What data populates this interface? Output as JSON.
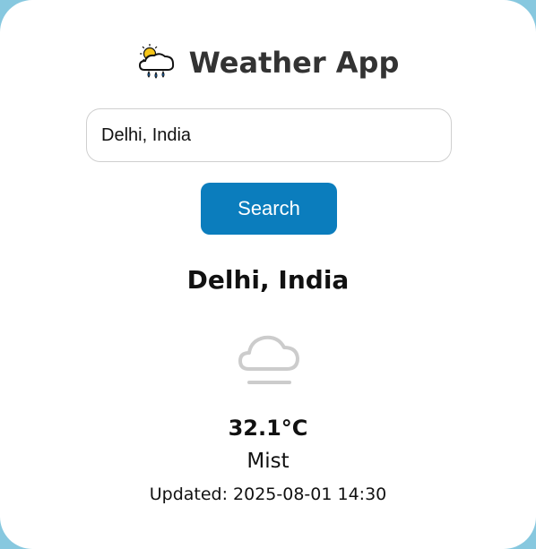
{
  "app": {
    "title": "Weather App",
    "icon": "cloud-sun-rain-icon"
  },
  "search": {
    "value": "Delhi, India",
    "button_label": "Search"
  },
  "result": {
    "city": "Delhi, India",
    "icon": "mist-icon",
    "temperature": "32.1°C",
    "condition": "Mist",
    "updated": "Updated: 2025-08-01 14:30"
  },
  "colors": {
    "background": "#87c8df",
    "card": "#ffffff",
    "accent": "#0b7dbd",
    "title": "#333333"
  }
}
